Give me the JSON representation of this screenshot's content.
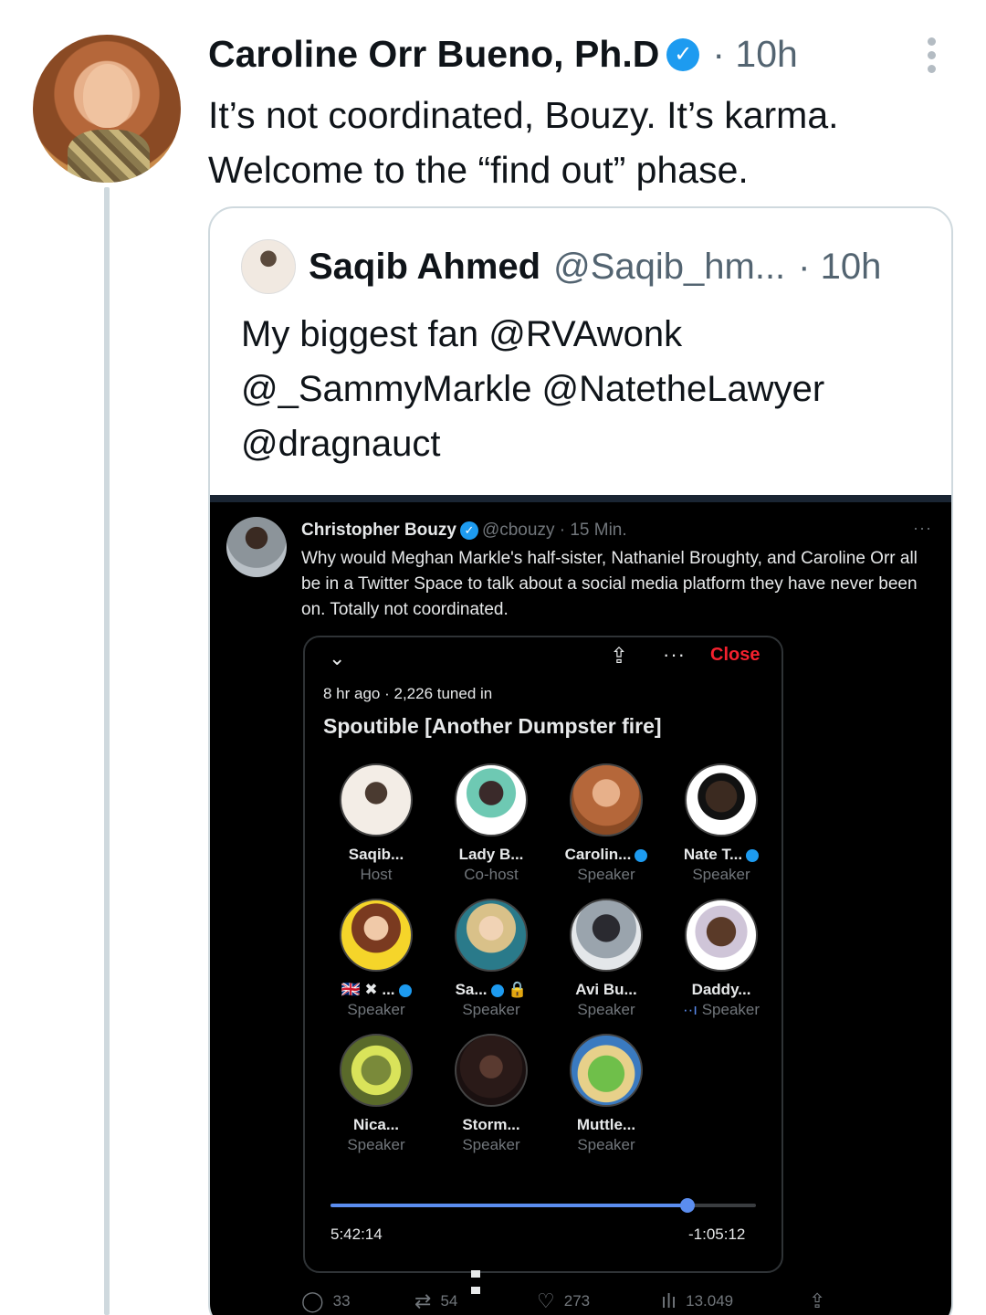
{
  "tweet": {
    "author_name": "Caroline Orr Bueno, Ph.D",
    "verified_icon": "verified-badge-icon",
    "time": "· 10h",
    "text_line1": "It’s not coordinated, Bouzy. It’s karma.",
    "text_line2": "Welcome to the “find out” phase."
  },
  "quote": {
    "author_name": "Saqib Ahmed",
    "handle": "@Saqib_hm...",
    "time": "· 10h",
    "text_line1": "My biggest fan @RVAwonk",
    "text_line2": "@_SammyMarkle @NatetheLawyer",
    "text_line3": "@dragnauct"
  },
  "embedded": {
    "author_name": "Christopher Bouzy",
    "handle": "@cbouzy · 15 Min.",
    "text": "Why would Meghan Markle's half-sister, Nathaniel Broughty, and Caroline Orr all be in a Twitter Space to talk about a social media platform they have never been on. Totally not coordinated.",
    "more": "···"
  },
  "space": {
    "close_label": "Close",
    "more": "···",
    "meta": "8 hr ago · 2,226 tuned in",
    "title": "Spoutible [Another Dumpster fire]",
    "participants": [
      {
        "name": "Saqib...",
        "role": "Host"
      },
      {
        "name": "Lady B...",
        "role": "Co-host"
      },
      {
        "name": "Carolin...",
        "role": "Speaker"
      },
      {
        "name": "Nate T...",
        "role": "Speaker"
      },
      {
        "name": "🇬🇧 ✖ ...",
        "role": "Speaker"
      },
      {
        "name": "Sa...",
        "role": "Speaker"
      },
      {
        "name": "Avi Bu...",
        "role": "Speaker"
      },
      {
        "name": "Daddy...",
        "role": "Speaker"
      },
      {
        "name": "Nica...",
        "role": "Speaker"
      },
      {
        "name": "Storm...",
        "role": "Speaker"
      },
      {
        "name": "Muttle...",
        "role": "Speaker"
      }
    ],
    "elapsed": "5:42:14",
    "remaining": "-1:05:12",
    "progress_fraction": 0.84
  },
  "actions": {
    "replies": "33",
    "retweets": "54",
    "likes": "273",
    "views": "13.049"
  },
  "colors": {
    "accent": "#1d9bf0",
    "close_red": "#f4212e",
    "progress_blue": "#5b8def"
  }
}
